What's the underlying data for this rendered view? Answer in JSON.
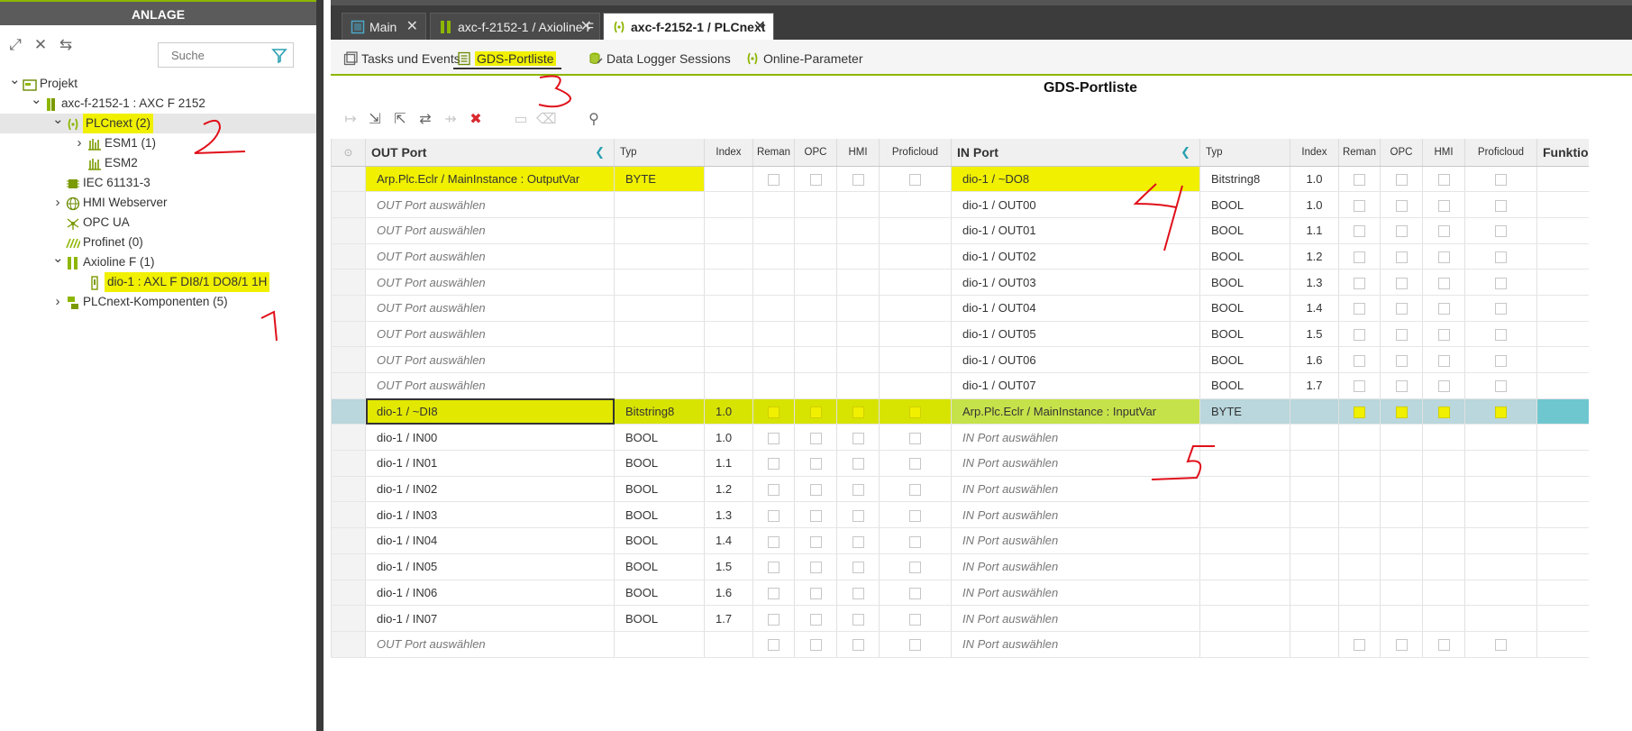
{
  "left": {
    "title": "ANLAGE",
    "search_placeholder": "Suche",
    "tree": [
      {
        "label": "Projekt",
        "level": 0,
        "expanded": true,
        "icon": "project-icon"
      },
      {
        "label": "axc-f-2152-1 : AXC F 2152",
        "level": 1,
        "expanded": true,
        "icon": "controller-icon"
      },
      {
        "label": "PLCnext (2)",
        "level": 2,
        "expanded": true,
        "icon": "plcnext-icon",
        "selected": true
      },
      {
        "label": "ESM1 (1)",
        "level": 3,
        "expanded": false,
        "icon": "esm-icon"
      },
      {
        "label": "ESM2",
        "level": 3,
        "icon": "esm-icon"
      },
      {
        "label": "IEC 61131-3",
        "level": 2,
        "icon": "iec-icon"
      },
      {
        "label": "HMI Webserver",
        "level": 2,
        "expanded": false,
        "icon": "globe-icon"
      },
      {
        "label": "OPC UA",
        "level": 2,
        "icon": "opcua-icon"
      },
      {
        "label": "Profinet (0)",
        "level": 2,
        "icon": "profinet-icon"
      },
      {
        "label": "Axioline F (1)",
        "level": 2,
        "expanded": true,
        "icon": "axioline-icon"
      },
      {
        "label": "dio-1 : AXL F DI8/1 DO8/1 1H",
        "level": 3,
        "icon": "module-icon"
      },
      {
        "label": "PLCnext-Komponenten (5)",
        "level": 2,
        "expanded": false,
        "icon": "components-icon"
      }
    ]
  },
  "tabs": [
    {
      "label": "Main"
    },
    {
      "label": "axc-f-2152-1 / Axioline F"
    },
    {
      "label": "axc-f-2152-1 / PLCnext"
    }
  ],
  "subtabs": [
    {
      "label": "Tasks und Events"
    },
    {
      "label": "GDS-Portliste"
    },
    {
      "label": "Data Logger Sessions"
    },
    {
      "label": "Online-Parameter"
    }
  ],
  "gds_title": "GDS-Portliste",
  "grid": {
    "headers": {
      "out_port": "OUT Port",
      "typ": "Typ",
      "index": "Index",
      "reman": "Reman",
      "opc": "OPC",
      "hmi": "HMI",
      "proficloud": "Proficloud",
      "in_port": "IN Port",
      "typ2": "Typ",
      "index2": "Index",
      "reman2": "Reman",
      "opc2": "OPC",
      "hmi2": "HMI",
      "proficloud2": "Proficloud",
      "funktion": "Funktio"
    },
    "rows": [
      {
        "out": "Arp.Plc.Eclr / MainInstance : OutputVar",
        "out_ph": false,
        "typ": "BYTE",
        "idx": "",
        "lcb": true,
        "in": "dio-1 / ~DO8",
        "in_ph": false,
        "typ2": "Bitstring8",
        "idx2": "1.0",
        "rcb": true,
        "style": "hl"
      },
      {
        "out": "OUT Port auswählen",
        "out_ph": true,
        "typ": "",
        "idx": "",
        "lcb": false,
        "in": "dio-1 / OUT00",
        "in_ph": false,
        "typ2": "BOOL",
        "idx2": "1.0",
        "rcb": true
      },
      {
        "out": "OUT Port auswählen",
        "out_ph": true,
        "typ": "",
        "idx": "",
        "lcb": false,
        "in": "dio-1 / OUT01",
        "in_ph": false,
        "typ2": "BOOL",
        "idx2": "1.1",
        "rcb": true
      },
      {
        "out": "OUT Port auswählen",
        "out_ph": true,
        "typ": "",
        "idx": "",
        "lcb": false,
        "in": "dio-1 / OUT02",
        "in_ph": false,
        "typ2": "BOOL",
        "idx2": "1.2",
        "rcb": true
      },
      {
        "out": "OUT Port auswählen",
        "out_ph": true,
        "typ": "",
        "idx": "",
        "lcb": false,
        "in": "dio-1 / OUT03",
        "in_ph": false,
        "typ2": "BOOL",
        "idx2": "1.3",
        "rcb": true
      },
      {
        "out": "OUT Port auswählen",
        "out_ph": true,
        "typ": "",
        "idx": "",
        "lcb": false,
        "in": "dio-1 / OUT04",
        "in_ph": false,
        "typ2": "BOOL",
        "idx2": "1.4",
        "rcb": true
      },
      {
        "out": "OUT Port auswählen",
        "out_ph": true,
        "typ": "",
        "idx": "",
        "lcb": false,
        "in": "dio-1 / OUT05",
        "in_ph": false,
        "typ2": "BOOL",
        "idx2": "1.5",
        "rcb": true
      },
      {
        "out": "OUT Port auswählen",
        "out_ph": true,
        "typ": "",
        "idx": "",
        "lcb": false,
        "in": "dio-1 / OUT06",
        "in_ph": false,
        "typ2": "BOOL",
        "idx2": "1.6",
        "rcb": true
      },
      {
        "out": "OUT Port auswählen",
        "out_ph": true,
        "typ": "",
        "idx": "",
        "lcb": false,
        "in": "dio-1 / OUT07",
        "in_ph": false,
        "typ2": "BOOL",
        "idx2": "1.7",
        "rcb": true
      },
      {
        "out": "dio-1 / ~DI8",
        "out_ph": false,
        "typ": "Bitstring8",
        "idx": "1.0",
        "lcb": true,
        "in": "Arp.Plc.Eclr / MainInstance : InputVar",
        "in_ph": false,
        "typ2": "BYTE",
        "idx2": "",
        "rcb": true,
        "style": "sel"
      },
      {
        "out": "dio-1 / IN00",
        "out_ph": false,
        "typ": "BOOL",
        "idx": "1.0",
        "lcb": true,
        "in": "IN Port auswählen",
        "in_ph": true,
        "typ2": "",
        "idx2": "",
        "rcb": false
      },
      {
        "out": "dio-1 / IN01",
        "out_ph": false,
        "typ": "BOOL",
        "idx": "1.1",
        "lcb": true,
        "in": "IN Port auswählen",
        "in_ph": true,
        "typ2": "",
        "idx2": "",
        "rcb": false
      },
      {
        "out": "dio-1 / IN02",
        "out_ph": false,
        "typ": "BOOL",
        "idx": "1.2",
        "lcb": true,
        "in": "IN Port auswählen",
        "in_ph": true,
        "typ2": "",
        "idx2": "",
        "rcb": false
      },
      {
        "out": "dio-1 / IN03",
        "out_ph": false,
        "typ": "BOOL",
        "idx": "1.3",
        "lcb": true,
        "in": "IN Port auswählen",
        "in_ph": true,
        "typ2": "",
        "idx2": "",
        "rcb": false
      },
      {
        "out": "dio-1 / IN04",
        "out_ph": false,
        "typ": "BOOL",
        "idx": "1.4",
        "lcb": true,
        "in": "IN Port auswählen",
        "in_ph": true,
        "typ2": "",
        "idx2": "",
        "rcb": false
      },
      {
        "out": "dio-1 / IN05",
        "out_ph": false,
        "typ": "BOOL",
        "idx": "1.5",
        "lcb": true,
        "in": "IN Port auswählen",
        "in_ph": true,
        "typ2": "",
        "idx2": "",
        "rcb": false
      },
      {
        "out": "dio-1 / IN06",
        "out_ph": false,
        "typ": "BOOL",
        "idx": "1.6",
        "lcb": true,
        "in": "IN Port auswählen",
        "in_ph": true,
        "typ2": "",
        "idx2": "",
        "rcb": false
      },
      {
        "out": "dio-1 / IN07",
        "out_ph": false,
        "typ": "BOOL",
        "idx": "1.7",
        "lcb": true,
        "in": "IN Port auswählen",
        "in_ph": true,
        "typ2": "",
        "idx2": "",
        "rcb": false
      },
      {
        "out": "OUT Port auswählen",
        "out_ph": true,
        "typ": "",
        "idx": "",
        "lcb": true,
        "in": "IN Port auswählen",
        "in_ph": true,
        "typ2": "",
        "idx2": "",
        "rcb": true
      }
    ]
  },
  "annotations": [
    "1",
    "2",
    "3",
    "4",
    "5"
  ],
  "colors": {
    "accent_green": "#8db600",
    "highlight_yellow": "#f0f000",
    "selection_teal": "#b9d7dc",
    "annotation_red": "#e0101a"
  }
}
